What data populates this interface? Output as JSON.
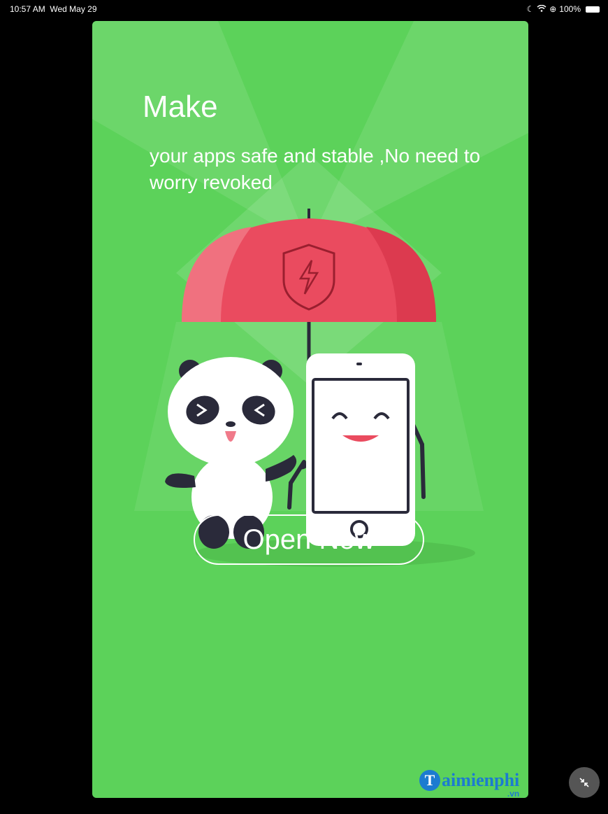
{
  "status_bar": {
    "time": "10:57 AM",
    "date": "Wed May 29",
    "battery": "100%",
    "icons": [
      "moon-icon",
      "wifi-icon",
      "lock-rotation-icon",
      "battery-icon"
    ]
  },
  "splash": {
    "headline": "Make",
    "subline": "your apps safe and stable ,No need to worry revoked",
    "button_label": "Open Now",
    "background_color": "#5cd25a",
    "umbrella_color": "#ea4b5f"
  },
  "watermark": {
    "brand": "aimienphi",
    "logo_letter": "T",
    "tld": ".vn"
  },
  "floating_control": {
    "icon": "shrink-icon"
  }
}
